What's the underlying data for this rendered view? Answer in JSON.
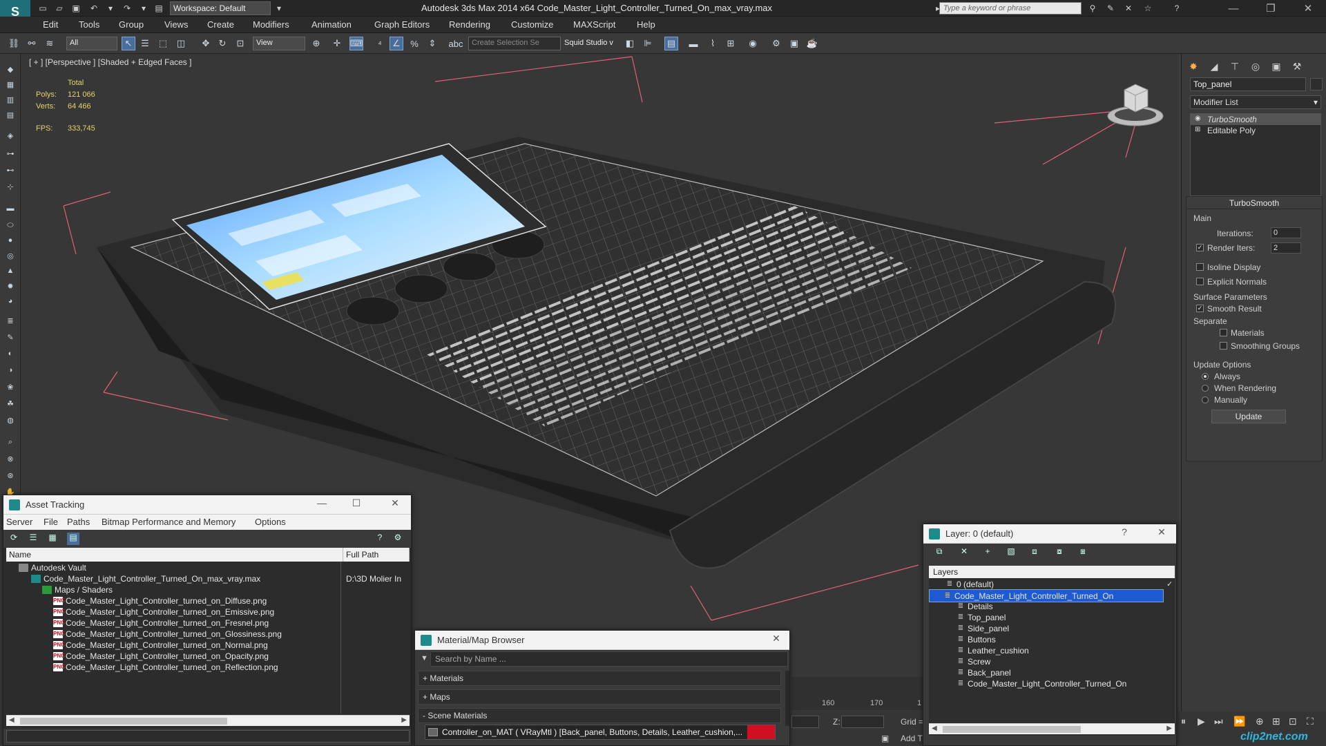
{
  "app": {
    "title": "Autodesk 3ds Max  2014 x64     Code_Master_Light_Controller_Turned_On_max_vray.max",
    "workspace": "Workspace: Default",
    "search_placeholder": "Type a keyword or phrase"
  },
  "menu": [
    "Edit",
    "Tools",
    "Group",
    "Views",
    "Create",
    "Modifiers",
    "Animation",
    "Graph Editors",
    "Rendering",
    "Customize",
    "MAXScript",
    "Help"
  ],
  "toolbar": {
    "selection_filter": "All",
    "ref_coord": "View",
    "selection_set": "Create Selection Se",
    "squid": "Squid Studio v"
  },
  "viewport": {
    "label": "[ + ] [Perspective ] [Shaded + Edged Faces ]",
    "stats": {
      "total_label": "Total",
      "polys_label": "Polys:",
      "polys": "121 066",
      "verts_label": "Verts:",
      "verts": "64 466",
      "fps_label": "FPS:",
      "fps": "333,745"
    }
  },
  "command_panel": {
    "object_name": "Top_panel",
    "modifier_list": "Modifier List",
    "stack": [
      "TurboSmooth",
      "Editable Poly"
    ],
    "turbosmooth": {
      "title": "TurboSmooth",
      "main": "Main",
      "iterations_label": "Iterations:",
      "iterations": "0",
      "render_iters_label": "Render Iters:",
      "render_iters": "2",
      "isoline": "Isoline Display",
      "explicit": "Explicit Normals",
      "surface": "Surface Parameters",
      "smooth_result": "Smooth Result",
      "separate": "Separate",
      "materials": "Materials",
      "smoothing_groups": "Smoothing Groups",
      "update_options": "Update Options",
      "always": "Always",
      "when_rendering": "When Rendering",
      "manually": "Manually",
      "update": "Update"
    }
  },
  "asset_tracking": {
    "title": "Asset Tracking",
    "menu": [
      "Server",
      "File",
      "Paths",
      "Bitmap Performance and Memory",
      "Options"
    ],
    "col_name": "Name",
    "col_path": "Full Path",
    "rows": [
      {
        "name": "Autodesk Vault",
        "path": "",
        "icon": "vault"
      },
      {
        "name": "Code_Master_Light_Controller_Turned_On_max_vray.max",
        "path": "D:\\3D Molier In",
        "icon": "max"
      },
      {
        "name": "Maps / Shaders",
        "path": "",
        "icon": "maps"
      },
      {
        "name": "Code_Master_Light_Controller_turned_on_Diffuse.png",
        "path": "",
        "icon": "png"
      },
      {
        "name": "Code_Master_Light_Controller_turned_on_Emissive.png",
        "path": "",
        "icon": "png"
      },
      {
        "name": "Code_Master_Light_Controller_turned_on_Fresnel.png",
        "path": "",
        "icon": "png"
      },
      {
        "name": "Code_Master_Light_Controller_turned_on_Glossiness.png",
        "path": "",
        "icon": "png"
      },
      {
        "name": "Code_Master_Light_Controller_turned_on_Normal.png",
        "path": "",
        "icon": "png"
      },
      {
        "name": "Code_Master_Light_Controller_turned_on_Opacity.png",
        "path": "",
        "icon": "png"
      },
      {
        "name": "Code_Master_Light_Controller_turned_on_Reflection.png",
        "path": "",
        "icon": "png"
      }
    ],
    "png_badge": "PNG"
  },
  "material_browser": {
    "title": "Material/Map Browser",
    "search_placeholder": "Search by Name ...",
    "materials": "+ Materials",
    "maps": "+ Maps",
    "scene_materials": "- Scene Materials",
    "scene_item": "Controller_on_MAT  ( VRayMtl )  [Back_panel, Buttons, Details, Leather_cushion,..."
  },
  "layer_dialog": {
    "title": "Layer: 0 (default)",
    "header": "Layers",
    "layers": [
      {
        "name": "0 (default)",
        "level": 0,
        "selected": false
      },
      {
        "name": "Code_Master_Light_Controller_Turned_On",
        "level": 0,
        "selected": true
      },
      {
        "name": "Details",
        "level": 1,
        "selected": false
      },
      {
        "name": "Top_panel",
        "level": 1,
        "selected": false
      },
      {
        "name": "Side_panel",
        "level": 1,
        "selected": false
      },
      {
        "name": "Buttons",
        "level": 1,
        "selected": false
      },
      {
        "name": "Leather_cushion",
        "level": 1,
        "selected": false
      },
      {
        "name": "Screw",
        "level": 1,
        "selected": false
      },
      {
        "name": "Back_panel",
        "level": 1,
        "selected": false
      },
      {
        "name": "Code_Master_Light_Controller_Turned_On",
        "level": 1,
        "selected": false
      }
    ]
  },
  "timeline": {
    "ticks": [
      "160",
      "170",
      "1"
    ],
    "z_label": "Z:",
    "grid_label": "Grid =",
    "add_label": "Add T"
  },
  "watermark": "clip2net.com"
}
